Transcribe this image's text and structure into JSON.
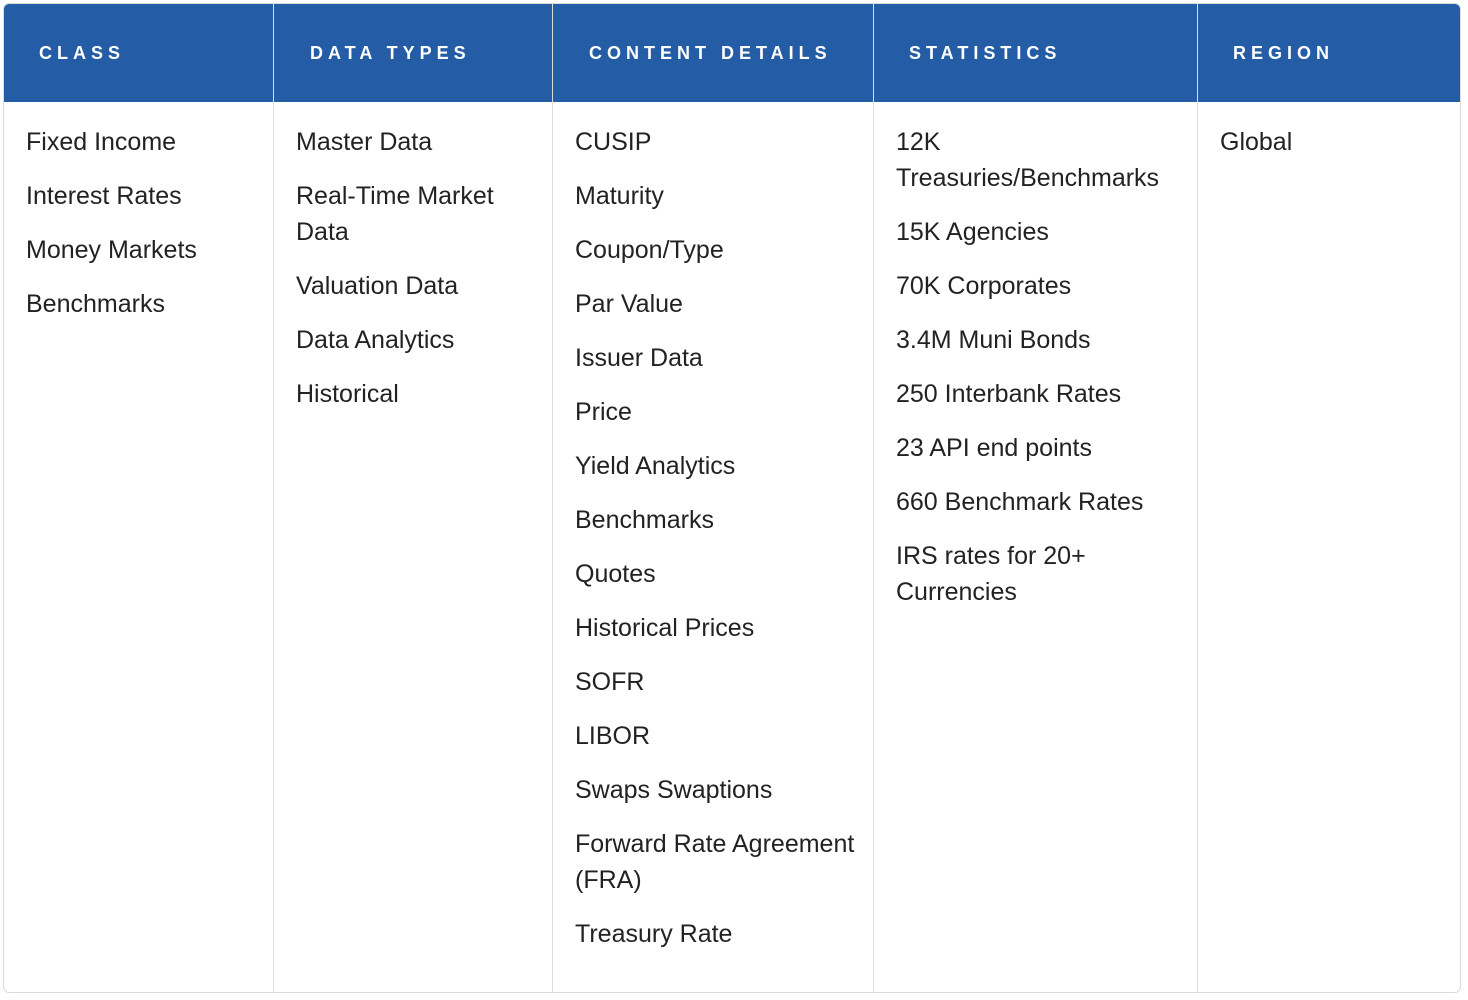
{
  "columns": [
    {
      "header": "Class",
      "items": [
        "Fixed Income",
        "Interest Rates",
        "Money Markets",
        "Benchmarks"
      ]
    },
    {
      "header": "Data Types",
      "items": [
        "Master Data",
        "Real-Time Market Data",
        "Valuation Data",
        "Data Analytics",
        "Historical"
      ]
    },
    {
      "header": "Content Details",
      "items": [
        "CUSIP",
        "Maturity",
        "Coupon/Type",
        "Par Value",
        "Issuer Data",
        "Price",
        "Yield Analytics",
        "Benchmarks",
        "Quotes",
        "Historical Prices",
        "SOFR",
        "LIBOR",
        "Swaps Swaptions",
        "Forward Rate Agreement (FRA)",
        "Treasury Rate"
      ]
    },
    {
      "header": "Statistics",
      "items": [
        "12K Treasuries/Benchmarks",
        "15K Agencies",
        "70K Corporates",
        "3.4M Muni Bonds",
        "250 Interbank Rates",
        "23 API end points",
        "660 Benchmark Rates",
        "IRS rates for 20+ Currencies"
      ]
    },
    {
      "header": "Region",
      "items": [
        "Global"
      ]
    }
  ],
  "colors": {
    "header_background": "#255ca6",
    "header_text": "#ffffff",
    "body_text": "#222222",
    "border": "#dcdcdc"
  }
}
